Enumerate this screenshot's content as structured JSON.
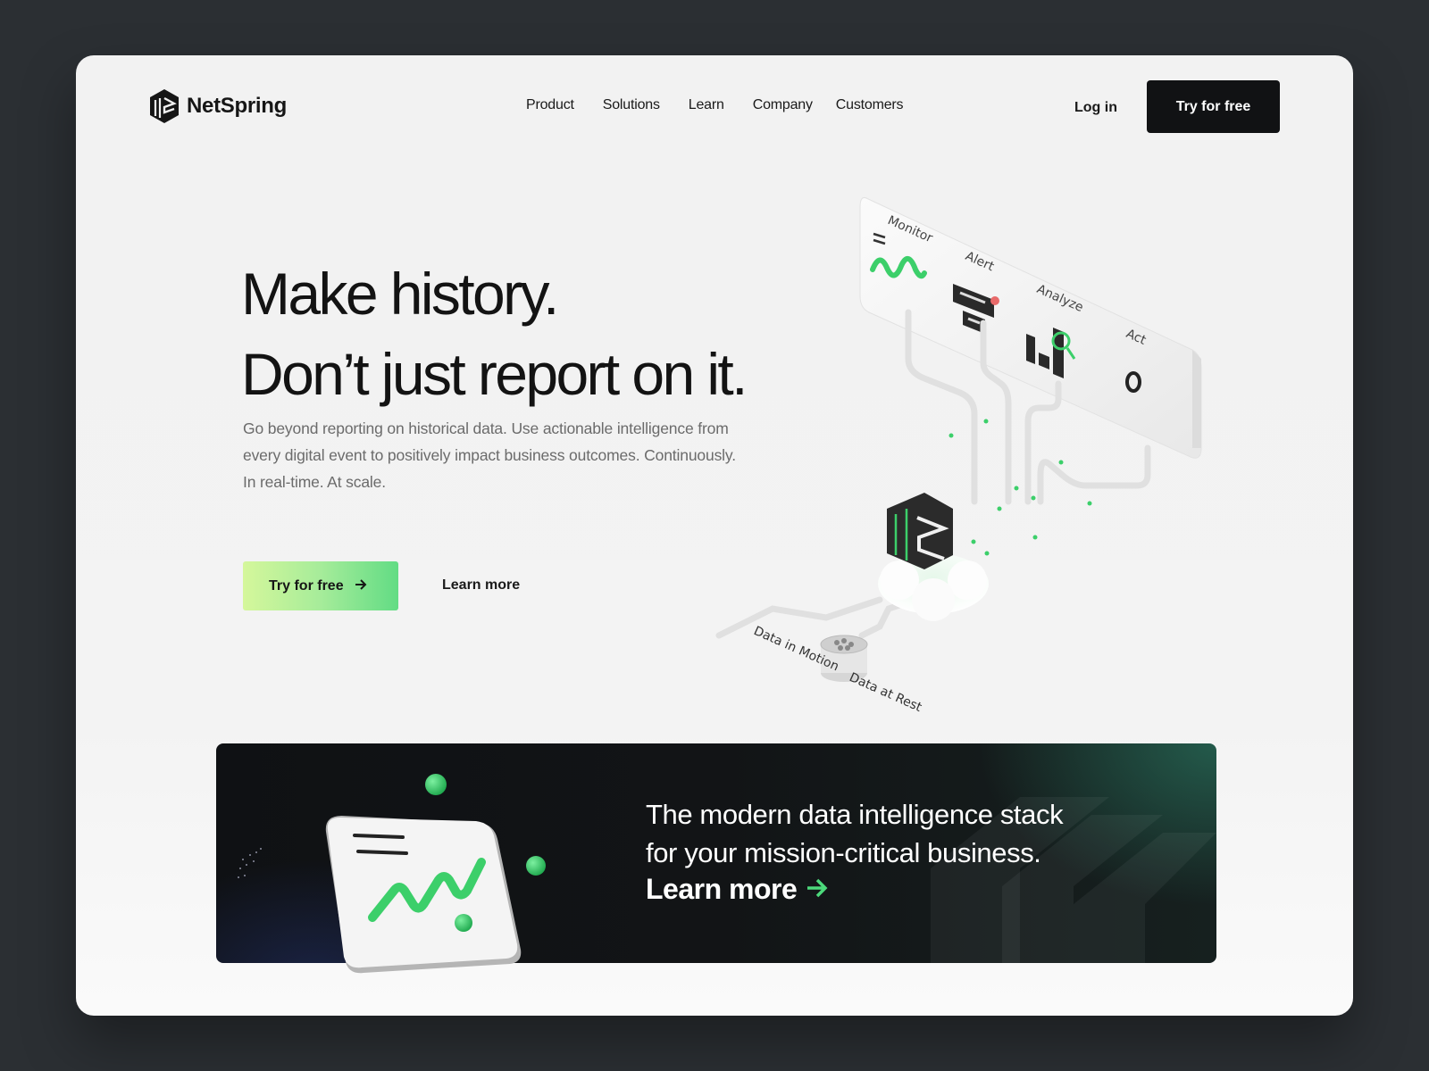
{
  "brand": {
    "name": "NetSpring",
    "logo_icon": "netspring-hex-logo-icon"
  },
  "nav": {
    "items": [
      {
        "label": "Product"
      },
      {
        "label": "Solutions"
      },
      {
        "label": "Learn"
      },
      {
        "label": "Company"
      },
      {
        "label": "Customers"
      }
    ],
    "login_label": "Log in",
    "cta_label": "Try for free"
  },
  "hero": {
    "headline_line1": "Make history.",
    "headline_line2": "Don’t just report on it.",
    "subtext": "Go beyond reporting on historical data. Use actionable intelligence from every digital event to positively impact business outcomes. Continuously. In real-time.  At scale.",
    "primary_button": {
      "label": "Try for free",
      "icon": "arrow-right-icon"
    },
    "secondary_link": "Learn more"
  },
  "illustration": {
    "stages": [
      "Monitor",
      "Alert",
      "Analyze",
      "Act"
    ],
    "sources": [
      "Data in Motion",
      "Data at Rest"
    ]
  },
  "banner": {
    "line1": "The modern data intelligence stack",
    "line2": "for your mission-critical business.",
    "link_label": "Learn more",
    "link_icon": "arrow-right-icon"
  },
  "colors": {
    "page_bg": "#2b2f33",
    "card_bg": "#f2f2f2",
    "dark_button": "#111214",
    "accent_green": "#4cd97b",
    "gradient_start": "#d5f79b",
    "gradient_end": "#62dc84",
    "alert_red": "#e86a6a"
  }
}
